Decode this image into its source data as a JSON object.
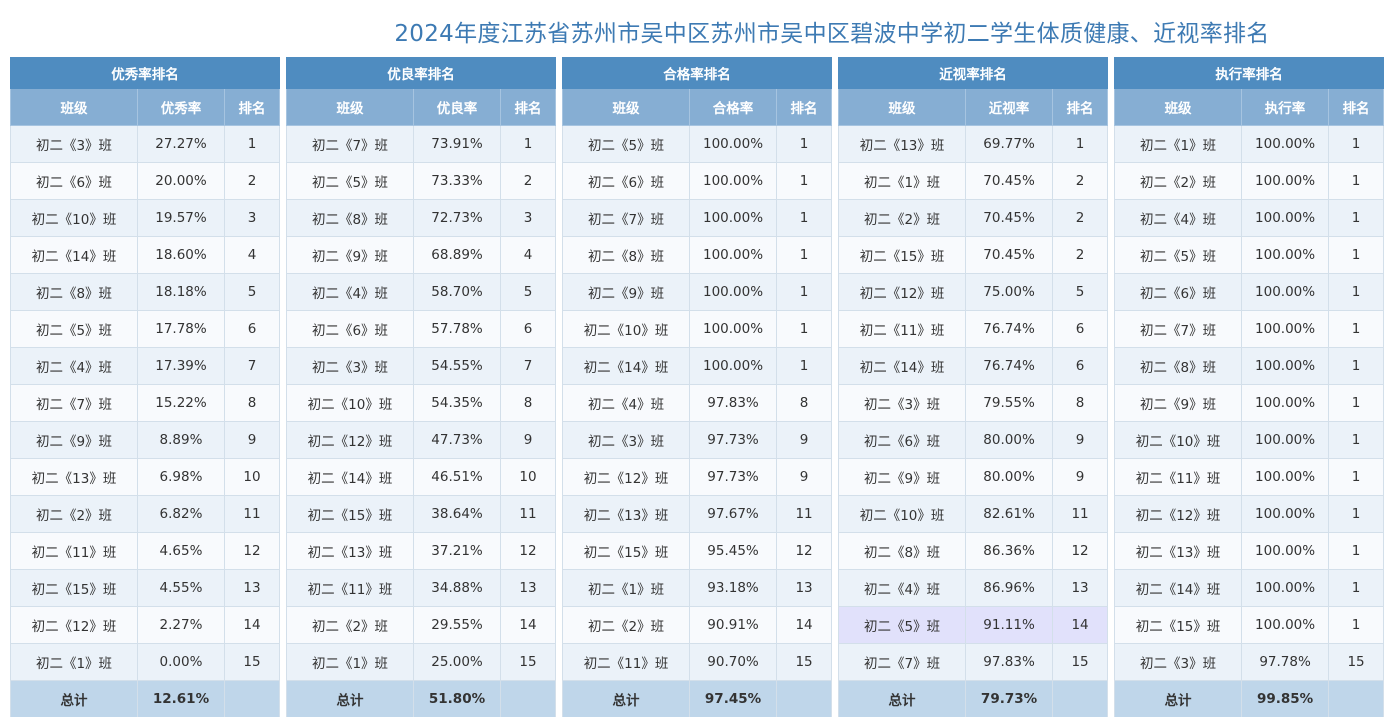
{
  "title": "2024年度江苏省苏州市吴中区苏州市吴中区碧波中学初二学生体质健康、近视率排名",
  "highlight_color": "#e1e1fb",
  "tables": [
    {
      "title": "优秀率排名",
      "headers": [
        "班级",
        "优秀率",
        "排名"
      ],
      "rows": [
        [
          "初二《3》班",
          "27.27%",
          "1"
        ],
        [
          "初二《6》班",
          "20.00%",
          "2"
        ],
        [
          "初二《10》班",
          "19.57%",
          "3"
        ],
        [
          "初二《14》班",
          "18.60%",
          "4"
        ],
        [
          "初二《8》班",
          "18.18%",
          "5"
        ],
        [
          "初二《5》班",
          "17.78%",
          "6"
        ],
        [
          "初二《4》班",
          "17.39%",
          "7"
        ],
        [
          "初二《7》班",
          "15.22%",
          "8"
        ],
        [
          "初二《9》班",
          "8.89%",
          "9"
        ],
        [
          "初二《13》班",
          "6.98%",
          "10"
        ],
        [
          "初二《2》班",
          "6.82%",
          "11"
        ],
        [
          "初二《11》班",
          "4.65%",
          "12"
        ],
        [
          "初二《15》班",
          "4.55%",
          "13"
        ],
        [
          "初二《12》班",
          "2.27%",
          "14"
        ],
        [
          "初二《1》班",
          "0.00%",
          "15"
        ]
      ],
      "total": [
        "总计",
        "12.61%",
        ""
      ],
      "highlight_row": -1
    },
    {
      "title": "优良率排名",
      "headers": [
        "班级",
        "优良率",
        "排名"
      ],
      "rows": [
        [
          "初二《7》班",
          "73.91%",
          "1"
        ],
        [
          "初二《5》班",
          "73.33%",
          "2"
        ],
        [
          "初二《8》班",
          "72.73%",
          "3"
        ],
        [
          "初二《9》班",
          "68.89%",
          "4"
        ],
        [
          "初二《4》班",
          "58.70%",
          "5"
        ],
        [
          "初二《6》班",
          "57.78%",
          "6"
        ],
        [
          "初二《3》班",
          "54.55%",
          "7"
        ],
        [
          "初二《10》班",
          "54.35%",
          "8"
        ],
        [
          "初二《12》班",
          "47.73%",
          "9"
        ],
        [
          "初二《14》班",
          "46.51%",
          "10"
        ],
        [
          "初二《15》班",
          "38.64%",
          "11"
        ],
        [
          "初二《13》班",
          "37.21%",
          "12"
        ],
        [
          "初二《11》班",
          "34.88%",
          "13"
        ],
        [
          "初二《2》班",
          "29.55%",
          "14"
        ],
        [
          "初二《1》班",
          "25.00%",
          "15"
        ]
      ],
      "total": [
        "总计",
        "51.80%",
        ""
      ],
      "highlight_row": -1
    },
    {
      "title": "合格率排名",
      "headers": [
        "班级",
        "合格率",
        "排名"
      ],
      "rows": [
        [
          "初二《5》班",
          "100.00%",
          "1"
        ],
        [
          "初二《6》班",
          "100.00%",
          "1"
        ],
        [
          "初二《7》班",
          "100.00%",
          "1"
        ],
        [
          "初二《8》班",
          "100.00%",
          "1"
        ],
        [
          "初二《9》班",
          "100.00%",
          "1"
        ],
        [
          "初二《10》班",
          "100.00%",
          "1"
        ],
        [
          "初二《14》班",
          "100.00%",
          "1"
        ],
        [
          "初二《4》班",
          "97.83%",
          "8"
        ],
        [
          "初二《3》班",
          "97.73%",
          "9"
        ],
        [
          "初二《12》班",
          "97.73%",
          "9"
        ],
        [
          "初二《13》班",
          "97.67%",
          "11"
        ],
        [
          "初二《15》班",
          "95.45%",
          "12"
        ],
        [
          "初二《1》班",
          "93.18%",
          "13"
        ],
        [
          "初二《2》班",
          "90.91%",
          "14"
        ],
        [
          "初二《11》班",
          "90.70%",
          "15"
        ]
      ],
      "total": [
        "总计",
        "97.45%",
        ""
      ],
      "highlight_row": -1
    },
    {
      "title": "近视率排名",
      "headers": [
        "班级",
        "近视率",
        "排名"
      ],
      "rows": [
        [
          "初二《13》班",
          "69.77%",
          "1"
        ],
        [
          "初二《1》班",
          "70.45%",
          "2"
        ],
        [
          "初二《2》班",
          "70.45%",
          "2"
        ],
        [
          "初二《15》班",
          "70.45%",
          "2"
        ],
        [
          "初二《12》班",
          "75.00%",
          "5"
        ],
        [
          "初二《11》班",
          "76.74%",
          "6"
        ],
        [
          "初二《14》班",
          "76.74%",
          "6"
        ],
        [
          "初二《3》班",
          "79.55%",
          "8"
        ],
        [
          "初二《6》班",
          "80.00%",
          "9"
        ],
        [
          "初二《9》班",
          "80.00%",
          "9"
        ],
        [
          "初二《10》班",
          "82.61%",
          "11"
        ],
        [
          "初二《8》班",
          "86.36%",
          "12"
        ],
        [
          "初二《4》班",
          "86.96%",
          "13"
        ],
        [
          "初二《5》班",
          "91.11%",
          "14"
        ],
        [
          "初二《7》班",
          "97.83%",
          "15"
        ]
      ],
      "total": [
        "总计",
        "79.73%",
        ""
      ],
      "highlight_row": 13
    },
    {
      "title": "执行率排名",
      "headers": [
        "班级",
        "执行率",
        "排名"
      ],
      "rows": [
        [
          "初二《1》班",
          "100.00%",
          "1"
        ],
        [
          "初二《2》班",
          "100.00%",
          "1"
        ],
        [
          "初二《4》班",
          "100.00%",
          "1"
        ],
        [
          "初二《5》班",
          "100.00%",
          "1"
        ],
        [
          "初二《6》班",
          "100.00%",
          "1"
        ],
        [
          "初二《7》班",
          "100.00%",
          "1"
        ],
        [
          "初二《8》班",
          "100.00%",
          "1"
        ],
        [
          "初二《9》班",
          "100.00%",
          "1"
        ],
        [
          "初二《10》班",
          "100.00%",
          "1"
        ],
        [
          "初二《11》班",
          "100.00%",
          "1"
        ],
        [
          "初二《12》班",
          "100.00%",
          "1"
        ],
        [
          "初二《13》班",
          "100.00%",
          "1"
        ],
        [
          "初二《14》班",
          "100.00%",
          "1"
        ],
        [
          "初二《15》班",
          "100.00%",
          "1"
        ],
        [
          "初二《3》班",
          "97.78%",
          "15"
        ]
      ],
      "total": [
        "总计",
        "99.85%",
        ""
      ],
      "highlight_row": -1
    }
  ]
}
